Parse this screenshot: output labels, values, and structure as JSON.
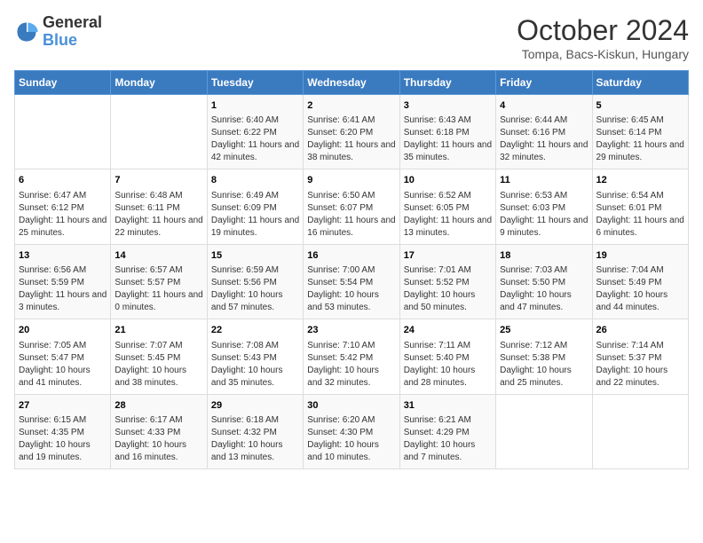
{
  "header": {
    "logo_general": "General",
    "logo_blue": "Blue",
    "title": "October 2024",
    "location": "Tompa, Bacs-Kiskun, Hungary"
  },
  "days_of_week": [
    "Sunday",
    "Monday",
    "Tuesday",
    "Wednesday",
    "Thursday",
    "Friday",
    "Saturday"
  ],
  "weeks": [
    [
      {
        "day": "",
        "content": ""
      },
      {
        "day": "",
        "content": ""
      },
      {
        "day": "1",
        "content": "Sunrise: 6:40 AM\nSunset: 6:22 PM\nDaylight: 11 hours and 42 minutes."
      },
      {
        "day": "2",
        "content": "Sunrise: 6:41 AM\nSunset: 6:20 PM\nDaylight: 11 hours and 38 minutes."
      },
      {
        "day": "3",
        "content": "Sunrise: 6:43 AM\nSunset: 6:18 PM\nDaylight: 11 hours and 35 minutes."
      },
      {
        "day": "4",
        "content": "Sunrise: 6:44 AM\nSunset: 6:16 PM\nDaylight: 11 hours and 32 minutes."
      },
      {
        "day": "5",
        "content": "Sunrise: 6:45 AM\nSunset: 6:14 PM\nDaylight: 11 hours and 29 minutes."
      }
    ],
    [
      {
        "day": "6",
        "content": "Sunrise: 6:47 AM\nSunset: 6:12 PM\nDaylight: 11 hours and 25 minutes."
      },
      {
        "day": "7",
        "content": "Sunrise: 6:48 AM\nSunset: 6:11 PM\nDaylight: 11 hours and 22 minutes."
      },
      {
        "day": "8",
        "content": "Sunrise: 6:49 AM\nSunset: 6:09 PM\nDaylight: 11 hours and 19 minutes."
      },
      {
        "day": "9",
        "content": "Sunrise: 6:50 AM\nSunset: 6:07 PM\nDaylight: 11 hours and 16 minutes."
      },
      {
        "day": "10",
        "content": "Sunrise: 6:52 AM\nSunset: 6:05 PM\nDaylight: 11 hours and 13 minutes."
      },
      {
        "day": "11",
        "content": "Sunrise: 6:53 AM\nSunset: 6:03 PM\nDaylight: 11 hours and 9 minutes."
      },
      {
        "day": "12",
        "content": "Sunrise: 6:54 AM\nSunset: 6:01 PM\nDaylight: 11 hours and 6 minutes."
      }
    ],
    [
      {
        "day": "13",
        "content": "Sunrise: 6:56 AM\nSunset: 5:59 PM\nDaylight: 11 hours and 3 minutes."
      },
      {
        "day": "14",
        "content": "Sunrise: 6:57 AM\nSunset: 5:57 PM\nDaylight: 11 hours and 0 minutes."
      },
      {
        "day": "15",
        "content": "Sunrise: 6:59 AM\nSunset: 5:56 PM\nDaylight: 10 hours and 57 minutes."
      },
      {
        "day": "16",
        "content": "Sunrise: 7:00 AM\nSunset: 5:54 PM\nDaylight: 10 hours and 53 minutes."
      },
      {
        "day": "17",
        "content": "Sunrise: 7:01 AM\nSunset: 5:52 PM\nDaylight: 10 hours and 50 minutes."
      },
      {
        "day": "18",
        "content": "Sunrise: 7:03 AM\nSunset: 5:50 PM\nDaylight: 10 hours and 47 minutes."
      },
      {
        "day": "19",
        "content": "Sunrise: 7:04 AM\nSunset: 5:49 PM\nDaylight: 10 hours and 44 minutes."
      }
    ],
    [
      {
        "day": "20",
        "content": "Sunrise: 7:05 AM\nSunset: 5:47 PM\nDaylight: 10 hours and 41 minutes."
      },
      {
        "day": "21",
        "content": "Sunrise: 7:07 AM\nSunset: 5:45 PM\nDaylight: 10 hours and 38 minutes."
      },
      {
        "day": "22",
        "content": "Sunrise: 7:08 AM\nSunset: 5:43 PM\nDaylight: 10 hours and 35 minutes."
      },
      {
        "day": "23",
        "content": "Sunrise: 7:10 AM\nSunset: 5:42 PM\nDaylight: 10 hours and 32 minutes."
      },
      {
        "day": "24",
        "content": "Sunrise: 7:11 AM\nSunset: 5:40 PM\nDaylight: 10 hours and 28 minutes."
      },
      {
        "day": "25",
        "content": "Sunrise: 7:12 AM\nSunset: 5:38 PM\nDaylight: 10 hours and 25 minutes."
      },
      {
        "day": "26",
        "content": "Sunrise: 7:14 AM\nSunset: 5:37 PM\nDaylight: 10 hours and 22 minutes."
      }
    ],
    [
      {
        "day": "27",
        "content": "Sunrise: 6:15 AM\nSunset: 4:35 PM\nDaylight: 10 hours and 19 minutes."
      },
      {
        "day": "28",
        "content": "Sunrise: 6:17 AM\nSunset: 4:33 PM\nDaylight: 10 hours and 16 minutes."
      },
      {
        "day": "29",
        "content": "Sunrise: 6:18 AM\nSunset: 4:32 PM\nDaylight: 10 hours and 13 minutes."
      },
      {
        "day": "30",
        "content": "Sunrise: 6:20 AM\nSunset: 4:30 PM\nDaylight: 10 hours and 10 minutes."
      },
      {
        "day": "31",
        "content": "Sunrise: 6:21 AM\nSunset: 4:29 PM\nDaylight: 10 hours and 7 minutes."
      },
      {
        "day": "",
        "content": ""
      },
      {
        "day": "",
        "content": ""
      }
    ]
  ]
}
